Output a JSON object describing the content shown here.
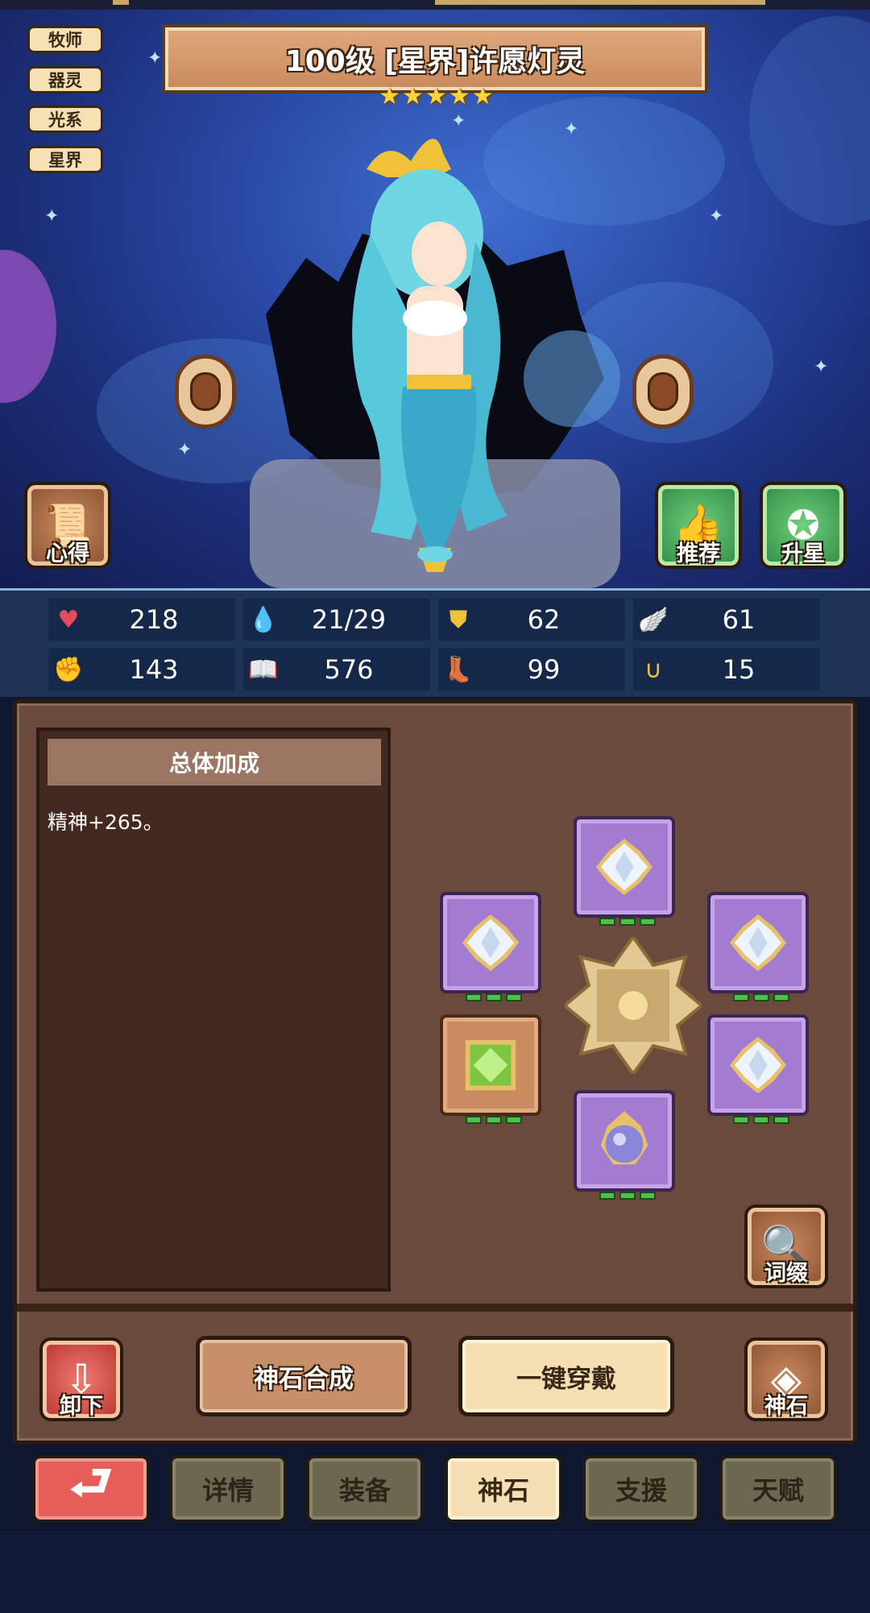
{
  "character": {
    "title": "100级 [星界]许愿灯灵",
    "star_count": 5,
    "tags": [
      "牧师",
      "器灵",
      "光系",
      "星界"
    ]
  },
  "side_buttons": {
    "insight_label": "心得",
    "recommend_label": "推荐",
    "star_up_label": "升星"
  },
  "stats": [
    {
      "icon": "heart-icon",
      "value": "218"
    },
    {
      "icon": "mana-drop-icon",
      "value": "21/29"
    },
    {
      "icon": "shield-icon",
      "value": "62"
    },
    {
      "icon": "wing-icon",
      "value": "61"
    },
    {
      "icon": "fist-icon",
      "value": "143"
    },
    {
      "icon": "spellbook-icon",
      "value": "576"
    },
    {
      "icon": "speed-boot-icon",
      "value": "99"
    },
    {
      "icon": "horseshoe-icon",
      "value": "15"
    }
  ],
  "bonus": {
    "title": "总体加成",
    "text": "精神+265。"
  },
  "sockets": [
    {
      "slot": "top",
      "gem": "white-diamond",
      "pips": 3
    },
    {
      "slot": "upper-left",
      "gem": "white-diamond",
      "pips": 3
    },
    {
      "slot": "upper-right",
      "gem": "white-diamond",
      "pips": 3
    },
    {
      "slot": "lower-left",
      "gem": "green-emerald",
      "pips": 3
    },
    {
      "slot": "lower-right",
      "gem": "white-diamond",
      "pips": 3
    },
    {
      "slot": "bottom",
      "gem": "purple-orb",
      "pips": 3
    }
  ],
  "actions": {
    "affix_label": "词缀",
    "unequip_label": "卸下",
    "merge_label": "神石合成",
    "equip_all_label": "一键穿戴",
    "godstone_label": "神石"
  },
  "tabs": {
    "back_symbol": "⮐",
    "items": [
      "详情",
      "装备",
      "神石",
      "支援",
      "天赋"
    ],
    "active": "神石"
  },
  "colors": {
    "star": "#ffd43b",
    "pip": "#4cc24a",
    "socket_purple": "#a37bd0",
    "panel": "#6a4a3c"
  }
}
